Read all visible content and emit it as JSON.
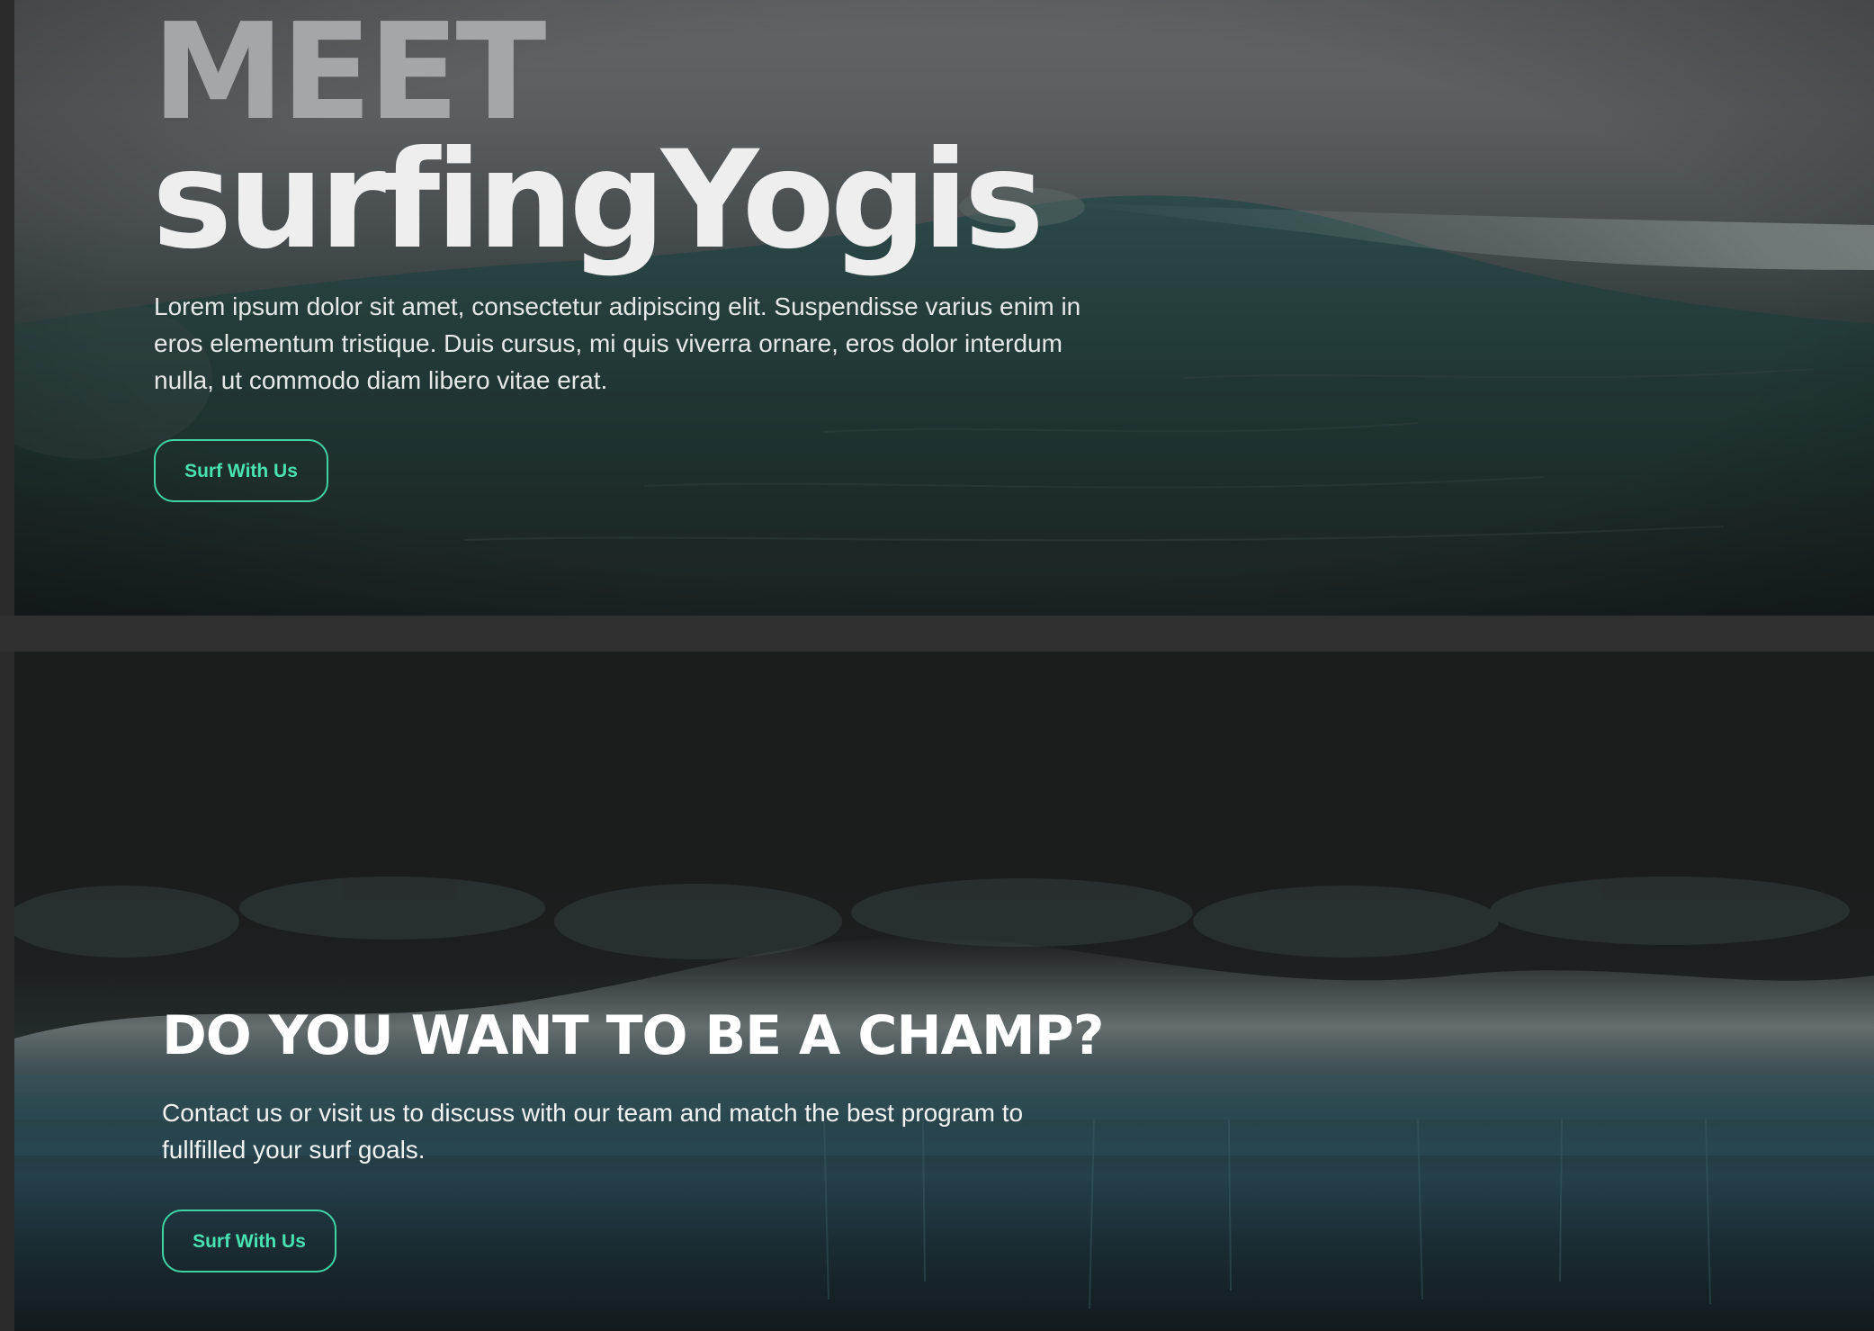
{
  "hero": {
    "eyebrow": "MEET",
    "title": "surfingYogis",
    "description": "Lorem ipsum dolor sit amet, consectetur adipiscing elit. Suspendisse varius enim in eros elementum tristique. Duis cursus, mi quis viverra ornare, eros dolor interdum nulla, ut commodo diam libero vitae erat.",
    "cta_label": "Surf With Us"
  },
  "champ": {
    "title": "DO YOU WANT TO BE A CHAMP?",
    "description": "Contact us or visit us to discuss with our team and match the best program to fullfilled your surf goals.",
    "cta_label": "Surf With Us"
  },
  "colors": {
    "accent": "#3fd3a6",
    "hero_title": "#eeeeee",
    "eyebrow": "#a4a7a9",
    "background_dark": "#1b1c1c"
  }
}
